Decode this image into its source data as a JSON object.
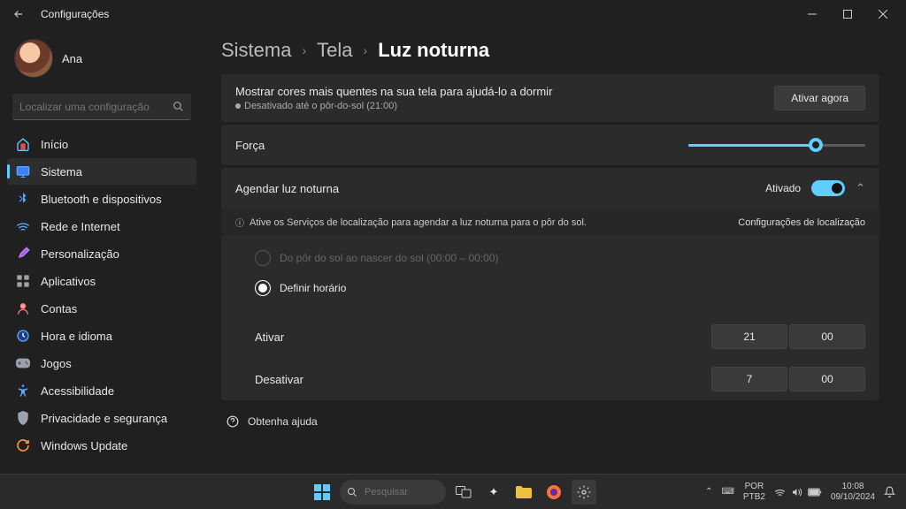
{
  "window": {
    "title": "Configurações"
  },
  "user": {
    "name": "Ana"
  },
  "search": {
    "placeholder": "Localizar uma configuração"
  },
  "nav": {
    "items": [
      {
        "label": "Início",
        "icon": "home"
      },
      {
        "label": "Sistema",
        "icon": "system"
      },
      {
        "label": "Bluetooth e dispositivos",
        "icon": "bluetooth"
      },
      {
        "label": "Rede e Internet",
        "icon": "wifi"
      },
      {
        "label": "Personalização",
        "icon": "brush"
      },
      {
        "label": "Aplicativos",
        "icon": "apps"
      },
      {
        "label": "Contas",
        "icon": "user"
      },
      {
        "label": "Hora e idioma",
        "icon": "clock"
      },
      {
        "label": "Jogos",
        "icon": "game"
      },
      {
        "label": "Acessibilidade",
        "icon": "accessibility"
      },
      {
        "label": "Privacidade e segurança",
        "icon": "shield"
      },
      {
        "label": "Windows Update",
        "icon": "update"
      }
    ],
    "active_index": 1
  },
  "breadcrumb": {
    "parts": [
      "Sistema",
      "Tela",
      "Luz noturna"
    ]
  },
  "night_light": {
    "description": "Mostrar cores mais quentes na sua tela para ajudá-lo a dormir",
    "status": "Desativado até o pôr-do-sol (21:00)",
    "turn_on_now": "Ativar agora",
    "strength_label": "Força",
    "strength_value": 72,
    "schedule_label": "Agendar luz noturna",
    "schedule_state": "Ativado",
    "location_hint": "Ative os Serviços de localização para agendar a luz noturna para o pôr do sol.",
    "location_link": "Configurações de localização",
    "option_sunset": "Do pôr do sol ao nascer do sol (00:00 – 00:00)",
    "option_set_hours": "Definir horário",
    "turn_on_label": "Ativar",
    "turn_on_hour": "21",
    "turn_on_minute": "00",
    "turn_off_label": "Desativar",
    "turn_off_hour": "7",
    "turn_off_minute": "00"
  },
  "help": {
    "label": "Obtenha ajuda"
  },
  "taskbar": {
    "search_placeholder": "Pesquisar",
    "lang": "POR",
    "kbd": "PTB2",
    "time": "10:08",
    "date": "09/10/2024"
  }
}
